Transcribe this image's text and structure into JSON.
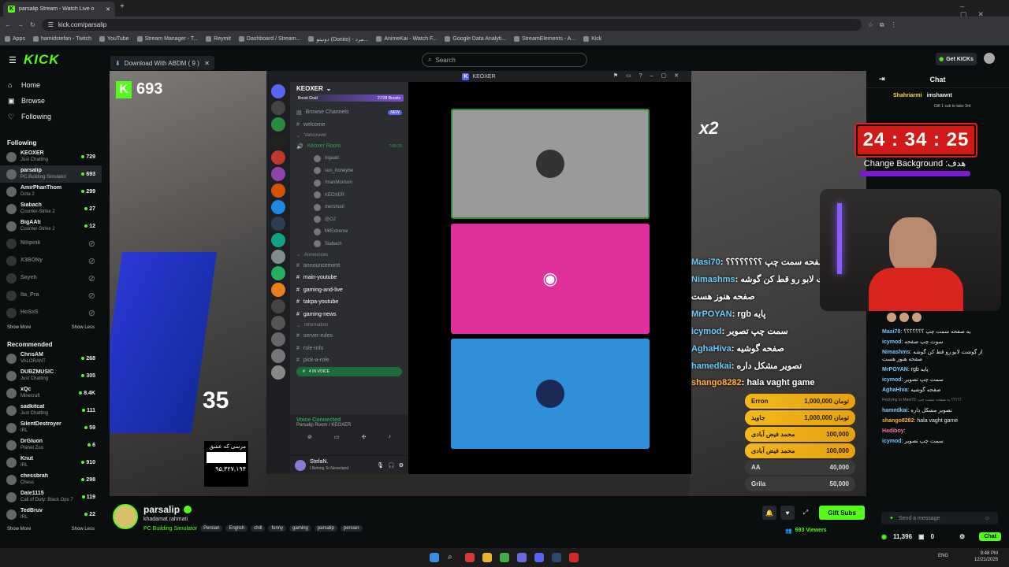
{
  "browser": {
    "tab_title": "parsalip Stream - Watch Live o",
    "url": "kick.com/parsalip",
    "bookmarks": [
      "Apps",
      "hamidstefan - Twitch",
      "YouTube",
      "Stream Manager - T...",
      "Reymit",
      "Dashboard / Stream...",
      "دونیتو (Donito) - مرد...",
      "AnimeKai - Watch F...",
      "Google Data Analyti...",
      "StreamElements - A...",
      "Kick"
    ]
  },
  "header": {
    "logo": "KICK",
    "download_banner": "Download With ABDM ( 9 )",
    "search_placeholder": "Search",
    "get_kicks": "Get KICKs"
  },
  "sidebar": {
    "nav": [
      {
        "label": "Home",
        "icon": "home-icon"
      },
      {
        "label": "Browse",
        "icon": "browse-icon"
      },
      {
        "label": "Following",
        "icon": "heart-icon"
      }
    ],
    "following_title": "Following",
    "following": [
      {
        "name": "KEOXER",
        "category": "Just Chatting",
        "viewers": "729",
        "live": true
      },
      {
        "name": "parsalip",
        "category": "PC Building Simulator",
        "viewers": "693",
        "live": true
      },
      {
        "name": "AmirPhanThom",
        "category": "Dota 2",
        "viewers": "299",
        "live": true
      },
      {
        "name": "Siabach",
        "category": "Counter-Strike 2",
        "viewers": "27",
        "live": true
      },
      {
        "name": "BigAAti",
        "category": "Counter-Strike 2",
        "viewers": "12",
        "live": true
      },
      {
        "name": "Nilipink",
        "category": "",
        "viewers": "",
        "live": false
      },
      {
        "name": "X3BONy",
        "category": "",
        "viewers": "",
        "live": false
      },
      {
        "name": "Sayeh",
        "category": "",
        "viewers": "",
        "live": false
      },
      {
        "name": "Ita_Pra",
        "category": "",
        "viewers": "",
        "live": false
      },
      {
        "name": "HoSiiS",
        "category": "",
        "viewers": "",
        "live": false
      }
    ],
    "show_more": "Show More",
    "show_less": "Show Less",
    "recommended_title": "Recommended",
    "recommended": [
      {
        "name": "ChrisAM",
        "category": "VALORANT",
        "viewers": "268"
      },
      {
        "name": "DUBZMUSIC",
        "category": "Just Chatting",
        "viewers": "305"
      },
      {
        "name": "xQc",
        "category": "Minecraft",
        "viewers": "8.4K"
      },
      {
        "name": "sadkitcat",
        "category": "Just Chatting",
        "viewers": "111"
      },
      {
        "name": "SilentDestroyer",
        "category": "IRL",
        "viewers": "59"
      },
      {
        "name": "DrGluon",
        "category": "Planet Zoo",
        "viewers": "6"
      },
      {
        "name": "Knut",
        "category": "IRL",
        "viewers": "910"
      },
      {
        "name": "chessbrah",
        "category": "Chess",
        "viewers": "298"
      },
      {
        "name": "Dale1115",
        "category": "Call of Duty: Black Ops 7",
        "viewers": "119"
      },
      {
        "name": "TedBruv",
        "category": "IRL",
        "viewers": "22"
      }
    ]
  },
  "video": {
    "kick_viewers": "693",
    "big_number": "35",
    "persian_text": "مرسی که عشق",
    "persian_amount": "۹۵,۳۲۷,۱۹۴",
    "x2": "x2",
    "timer": "24 : 34 : 25",
    "goal": "Change Background :هدف",
    "overlay_chat": [
      {
        "user": "Masi70",
        "text": "یه صفحه سمت چپ ؟؟؟؟؟؟؟؟"
      },
      {
        "user": "Nimashms",
        "text": "از گوشت لابو رو قط کن گوشه"
      },
      {
        "user": "",
        "text": "صفحه هنوز هست"
      },
      {
        "user": "MrPOYAN",
        "text": "rgb پایه"
      },
      {
        "user": "icymod",
        "text": "سمت چپ تصویر"
      },
      {
        "user": "AghaHiva",
        "text": "صفحه گوشیه"
      },
      {
        "user": "hamedkai",
        "text": "تصویر مشکل داره"
      },
      {
        "user": "shango8282",
        "text": "hala vaght game"
      }
    ],
    "donations": [
      {
        "name": "Erron",
        "amount": "1,000,000 تومان"
      },
      {
        "name": "جاوید",
        "amount": "1,000,000 تومان"
      },
      {
        "name": "محمد فیض آبادی",
        "amount": "100,000"
      },
      {
        "name": "محمد فیض آبادی",
        "amount": "100,000"
      },
      {
        "name": "AA",
        "amount": "40,000"
      },
      {
        "name": "Grila",
        "amount": "50,000"
      }
    ]
  },
  "discord": {
    "window_title": "KEOXER",
    "guild": "KEOXER",
    "boost_goal": "Boost Goal",
    "boost_count": "27/28 Boosts",
    "browse_channels": "Browse Channels",
    "new_badge": "NEW",
    "channels": [
      {
        "kind": "text",
        "label": "welcome"
      },
      {
        "kind": "cat",
        "label": "Vancouver"
      },
      {
        "kind": "voice",
        "label": "Keoxer Room",
        "time": "7:55:35"
      },
      {
        "kind": "user",
        "label": "bigaati"
      },
      {
        "kind": "user",
        "label": "iam_honeybe"
      },
      {
        "kind": "user",
        "label": "ImanMorison"
      },
      {
        "kind": "user",
        "label": "KEOXER"
      },
      {
        "kind": "user",
        "label": "mershool"
      },
      {
        "kind": "user",
        "label": "@OJ"
      },
      {
        "kind": "user",
        "label": "MrExtreme"
      },
      {
        "kind": "user",
        "label": "Siabach"
      },
      {
        "kind": "cat",
        "label": "Announces"
      },
      {
        "kind": "text",
        "label": "announcement"
      },
      {
        "kind": "text",
        "label": "main-youtube"
      },
      {
        "kind": "text",
        "label": "gaming-and-live"
      },
      {
        "kind": "text",
        "label": "takpa-youtube"
      },
      {
        "kind": "text",
        "label": "gaming-news"
      },
      {
        "kind": "cat",
        "label": "Information"
      },
      {
        "kind": "text",
        "label": "server-rules"
      },
      {
        "kind": "text",
        "label": "role-info"
      },
      {
        "kind": "text",
        "label": "pick-a-role"
      },
      {
        "kind": "text",
        "label": "4 IN VOICE"
      }
    ],
    "voice_connected": "Voice Connected",
    "voice_room": "Parsalip Room / KEOXER",
    "user_name": "StefaN.",
    "user_status": "I Belong To Neverland"
  },
  "chat": {
    "title": "Chat",
    "top_users": [
      "Shahriarmi",
      "imshawnt"
    ],
    "top_note": "Gift 1 sub to take 3rd",
    "messages": [
      {
        "user": "Masi70",
        "text": "یه صفحه سمت چپ ؟؟؟؟؟؟؟",
        "color": "#7cc6ff"
      },
      {
        "user": "icymod",
        "text": "سوت چپ صفحه",
        "color": "#7cc6ff"
      },
      {
        "user": "Nimashms",
        "text": "از گوشت لابو رو قط کن گوشه صفحه هنوز هست",
        "color": "#7cc6ff"
      },
      {
        "user": "MrPOYAN",
        "text": "rgb پایه",
        "color": "#7cc6ff"
      },
      {
        "user": "icymod",
        "text": "سمت چپ تصویر",
        "color": "#7cc6ff"
      },
      {
        "user": "AghaHiva",
        "text": "صفحه گوشیه",
        "color": "#7cc6ff"
      },
      {
        "user": "hamedkai",
        "text": "تصویر مشکل داره",
        "color": "#7cc6ff"
      },
      {
        "user": "shango8282",
        "text": "hala vaght game",
        "color": "#ffb13b"
      },
      {
        "user": "Hadiboy",
        "text": "",
        "color": "#ff6b9b"
      },
      {
        "user": "icymod",
        "text": "سمت چپ تصویر",
        "color": "#7cc6ff"
      }
    ],
    "reply_note": "Replying to Masi70: ؟؟؟؟؟ یه صفحه سمت چپ",
    "input_placeholder": "Send a message",
    "kicks_count": "11,396",
    "zero_count": "0",
    "chat_button": "Chat"
  },
  "stream_info": {
    "name": "parsalip",
    "title": "khadamat rahmati",
    "category": "PC Building Simulator",
    "tags": [
      "Persian",
      "English",
      "chill",
      "funny",
      "gaming",
      "parsalip",
      "persian"
    ],
    "viewers": "693 Viewers",
    "gift_subs": "Gift Subs"
  },
  "taskbar": {
    "lang": "ENG",
    "time": "9:48 PM",
    "date": "12/21/2025"
  },
  "colors": {
    "kick_green": "#53fc18",
    "timer_red": "#cf1a17",
    "discord_pink": "#e0309c",
    "discord_blue": "#2f8fd8"
  }
}
